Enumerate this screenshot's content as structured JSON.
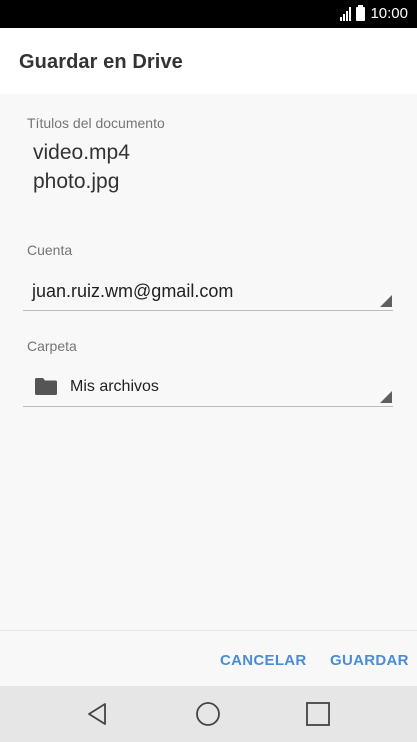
{
  "status_bar": {
    "time": "10:00",
    "signal_icon": "signal-icon",
    "battery_icon": "battery-icon"
  },
  "header": {
    "title": "Guardar en Drive"
  },
  "documents": {
    "label": "Títulos del documento",
    "titles": [
      "video.mp4",
      "photo.jpg"
    ]
  },
  "account": {
    "label": "Cuenta",
    "value": "juan.ruiz.wm@gmail.com"
  },
  "folder": {
    "label": "Carpeta",
    "value": "Mis archivos",
    "icon": "folder-icon"
  },
  "actions": {
    "cancel_label": "CANCELAR",
    "save_label": "GUARDAR"
  },
  "nav": {
    "back_icon": "back-icon",
    "home_icon": "home-icon",
    "recents_icon": "recents-icon"
  },
  "colors": {
    "accent": "#4a8dd6",
    "header_bg": "#ffffff",
    "nav_bg": "#e6e6e6"
  }
}
